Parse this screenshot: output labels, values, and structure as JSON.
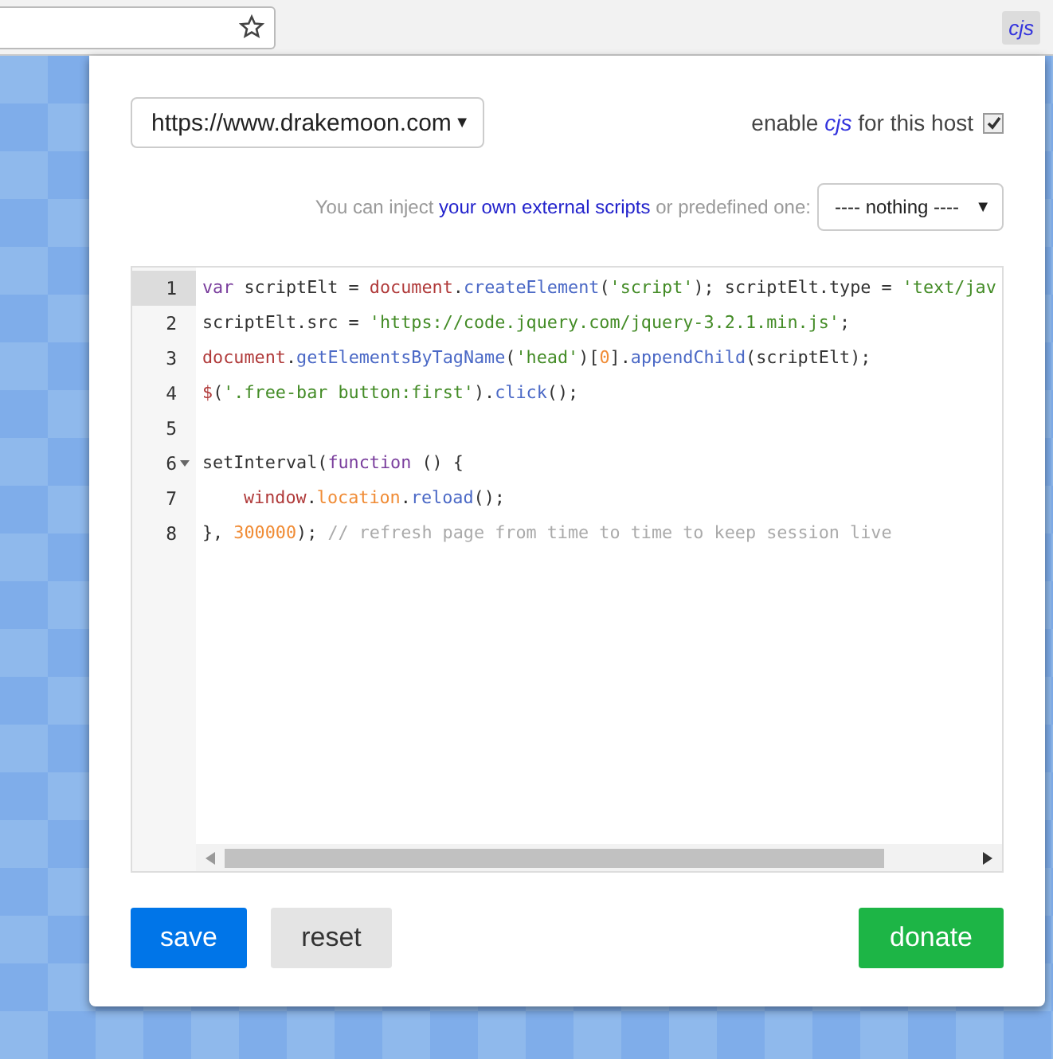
{
  "browser": {
    "extension_label": "cjs"
  },
  "popup": {
    "host_select": {
      "value": "https://www.drakemoon.com",
      "arrow": "▼"
    },
    "enable": {
      "before": "enable",
      "name": "cjs",
      "after": "for this host",
      "checked": true
    },
    "inject": {
      "before": "You can inject",
      "link": "your own external scripts",
      "after": "or predefined one:",
      "select": {
        "value": "---- nothing ----",
        "arrow": "▼"
      }
    },
    "editor": {
      "lines": [
        {
          "number": "1",
          "active": true,
          "fold": false,
          "indented": false,
          "tokens": [
            {
              "kind": "keyword",
              "text": "var"
            },
            {
              "kind": "plain",
              "text": " scriptElt = "
            },
            {
              "kind": "builtin",
              "text": "document"
            },
            {
              "kind": "plain",
              "text": "."
            },
            {
              "kind": "prop",
              "text": "createElement"
            },
            {
              "kind": "plain",
              "text": "("
            },
            {
              "kind": "string",
              "text": "'script'"
            },
            {
              "kind": "plain",
              "text": "); scriptElt.type = "
            },
            {
              "kind": "string",
              "text": "'text/jav"
            }
          ]
        },
        {
          "number": "2",
          "active": false,
          "fold": false,
          "indented": false,
          "tokens": [
            {
              "kind": "plain",
              "text": "scriptElt.src = "
            },
            {
              "kind": "string",
              "text": "'https://code.jquery.com/jquery-3.2.1.min.js'"
            },
            {
              "kind": "plain",
              "text": ";"
            }
          ]
        },
        {
          "number": "3",
          "active": false,
          "fold": false,
          "indented": false,
          "tokens": [
            {
              "kind": "builtin",
              "text": "document"
            },
            {
              "kind": "plain",
              "text": "."
            },
            {
              "kind": "prop",
              "text": "getElementsByTagName"
            },
            {
              "kind": "plain",
              "text": "("
            },
            {
              "kind": "string",
              "text": "'head'"
            },
            {
              "kind": "plain",
              "text": ")["
            },
            {
              "kind": "number",
              "text": "0"
            },
            {
              "kind": "plain",
              "text": "]."
            },
            {
              "kind": "prop",
              "text": "appendChild"
            },
            {
              "kind": "plain",
              "text": "(scriptElt);"
            }
          ]
        },
        {
          "number": "4",
          "active": false,
          "fold": false,
          "indented": false,
          "tokens": [
            {
              "kind": "builtin",
              "text": "$"
            },
            {
              "kind": "plain",
              "text": "("
            },
            {
              "kind": "string",
              "text": "'.free-bar button:first'"
            },
            {
              "kind": "plain",
              "text": ")."
            },
            {
              "kind": "prop",
              "text": "click"
            },
            {
              "kind": "plain",
              "text": "();"
            }
          ]
        },
        {
          "number": "5",
          "active": false,
          "fold": false
        },
        {
          "number": "6",
          "active": false,
          "fold": true,
          "indented": false,
          "tokens": [
            {
              "kind": "plain",
              "text": "setInterval("
            },
            {
              "kind": "keyword",
              "text": "function"
            },
            {
              "kind": "plain",
              "text": " () {"
            }
          ]
        },
        {
          "number": "7",
          "active": false,
          "fold": false,
          "indented": true,
          "tokens": [
            {
              "kind": "builtin",
              "text": "window"
            },
            {
              "kind": "plain",
              "text": "."
            },
            {
              "kind": "number",
              "text": "location"
            },
            {
              "kind": "plain",
              "text": "."
            },
            {
              "kind": "prop",
              "text": "reload"
            },
            {
              "kind": "plain",
              "text": "();"
            }
          ]
        },
        {
          "number": "8",
          "active": false,
          "fold": false,
          "indented": false,
          "tokens": [
            {
              "kind": "plain",
              "text": "}, "
            },
            {
              "kind": "number",
              "text": "300000"
            },
            {
              "kind": "plain",
              "text": "); "
            },
            {
              "kind": "comment",
              "text": "// refresh page from time to time to keep session live"
            }
          ]
        }
      ]
    },
    "buttons": [
      {
        "label": "save",
        "kind": "primary"
      },
      {
        "label": "reset",
        "kind": "secondary"
      },
      {
        "label": "donate",
        "kind": "donate"
      }
    ]
  }
}
